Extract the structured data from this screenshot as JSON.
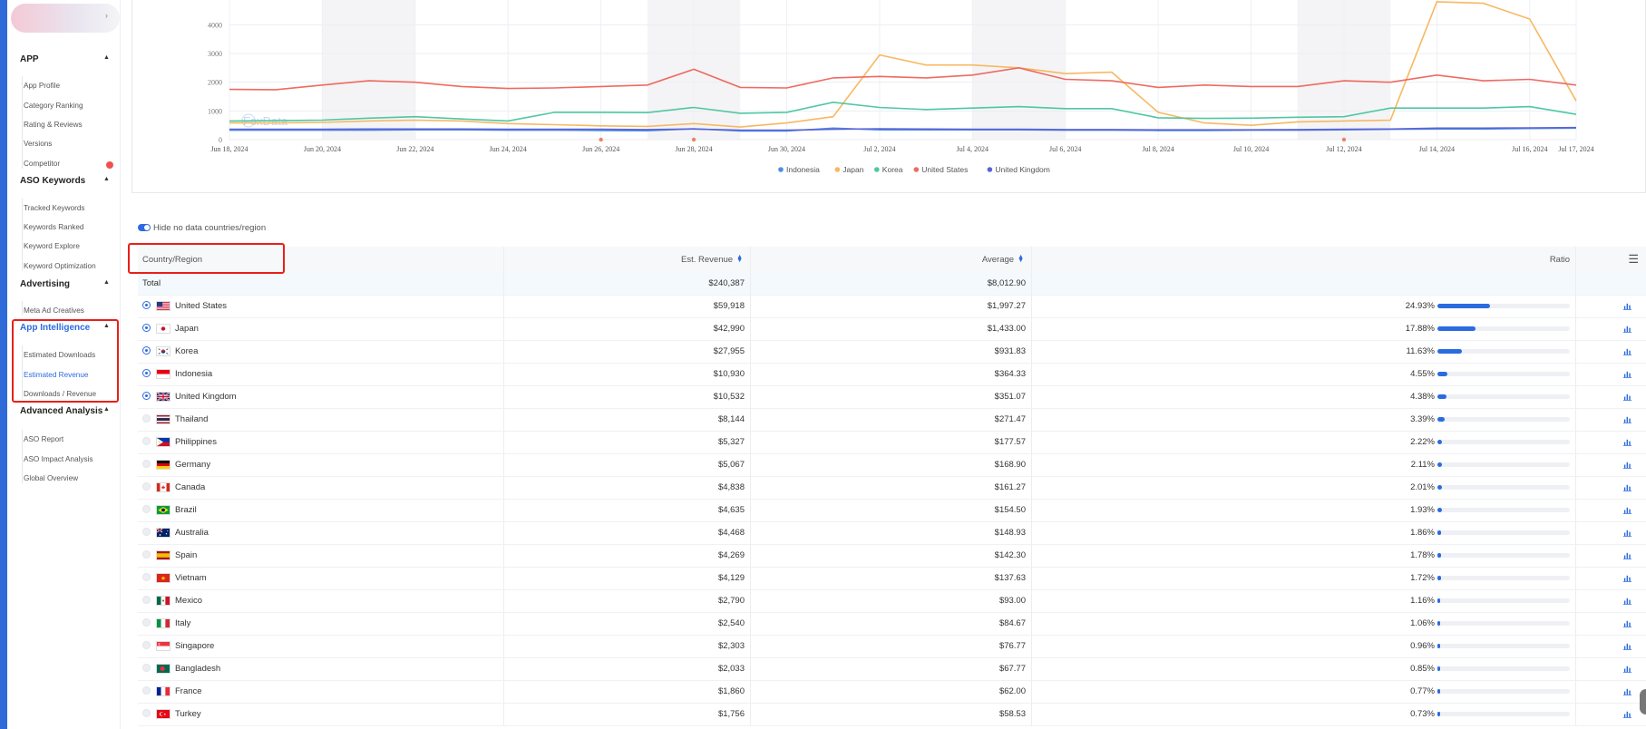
{
  "sidebar": {
    "sections": [
      {
        "title": "APP",
        "items": [
          "App Profile",
          "Category Ranking",
          "Rating & Reviews",
          "Versions",
          "Competitor"
        ]
      },
      {
        "title": "ASO Keywords",
        "items": [
          "Tracked Keywords",
          "Keywords Ranked",
          "Keyword Explore",
          "Keyword Optimization"
        ]
      },
      {
        "title": "Advertising",
        "items": [
          "Meta Ad Creatives"
        ]
      },
      {
        "title": "App Intelligence",
        "items": [
          "Estimated Downloads",
          "Estimated Revenue",
          "Downloads / Revenue"
        ]
      },
      {
        "title": "Advanced Analysis",
        "items": [
          "ASO Report",
          "ASO Impact Analysis",
          "Global Overview"
        ]
      }
    ],
    "active_section": "App Intelligence",
    "active_item": "Estimated Revenue",
    "accent_color": "#2d6be0"
  },
  "chart_data": {
    "type": "line",
    "x": [
      "Jun 18, 2024",
      "Jun 19, 2024",
      "Jun 20, 2024",
      "Jun 21, 2024",
      "Jun 22, 2024",
      "Jun 23, 2024",
      "Jun 24, 2024",
      "Jun 25, 2024",
      "Jun 26, 2024",
      "Jun 27, 2024",
      "Jun 28, 2024",
      "Jun 29, 2024",
      "Jun 30, 2024",
      "Jul 1, 2024",
      "Jul 2, 2024",
      "Jul 3, 2024",
      "Jul 4, 2024",
      "Jul 5, 2024",
      "Jul 6, 2024",
      "Jul 7, 2024",
      "Jul 8, 2024",
      "Jul 9, 2024",
      "Jul 10, 2024",
      "Jul 11, 2024",
      "Jul 12, 2024",
      "Jul 13, 2024",
      "Jul 14, 2024",
      "Jul 15, 2024",
      "Jul 16, 2024",
      "Jul 17, 2024"
    ],
    "x_tick_labels": [
      "Jun 18, 2024",
      "Jun 20, 2024",
      "Jun 22, 2024",
      "Jun 24, 2024",
      "Jun 26, 2024",
      "Jun 28, 2024",
      "Jun 30, 2024",
      "Jul 2, 2024",
      "Jul 4, 2024",
      "Jul 6, 2024",
      "Jul 8, 2024",
      "Jul 10, 2024",
      "Jul 12, 2024",
      "Jul 14, 2024",
      "Jul 16, 2024",
      "Jul 17, 2024"
    ],
    "y_tick_labels": [
      "0",
      "1000",
      "2000",
      "3000",
      "4000"
    ],
    "ylim": [
      0,
      4800
    ],
    "series": [
      {
        "name": "Indonesia",
        "color": "#4d8fe0",
        "values": [
          330,
          330,
          330,
          330,
          340,
          340,
          330,
          330,
          320,
          310,
          380,
          300,
          300,
          400,
          340,
          340,
          340,
          340,
          330,
          330,
          320,
          320,
          330,
          330,
          340,
          360,
          370,
          370,
          390,
          400
        ]
      },
      {
        "name": "Japan",
        "color": "#f7b862",
        "values": [
          580,
          580,
          600,
          650,
          680,
          650,
          560,
          520,
          480,
          460,
          560,
          440,
          580,
          800,
          2950,
          2600,
          2600,
          2500,
          2300,
          2350,
          950,
          580,
          500,
          620,
          650,
          680,
          4800,
          4750,
          4200,
          1350
        ]
      },
      {
        "name": "Korea",
        "color": "#4fc7a3",
        "values": [
          650,
          660,
          680,
          750,
          800,
          720,
          650,
          950,
          950,
          940,
          1120,
          920,
          950,
          1300,
          1120,
          1050,
          1100,
          1150,
          1080,
          1080,
          760,
          740,
          750,
          780,
          800,
          1100,
          1100,
          1100,
          1150,
          880
        ]
      },
      {
        "name": "United States",
        "color": "#ef6a60",
        "values": [
          1750,
          1740,
          1900,
          2050,
          2000,
          1850,
          1780,
          1800,
          1850,
          1900,
          2450,
          1820,
          1800,
          2150,
          2200,
          2150,
          2250,
          2500,
          2100,
          2050,
          1820,
          1900,
          1850,
          1850,
          2050,
          2000,
          2250,
          2050,
          2100,
          1900
        ]
      },
      {
        "name": "United Kingdom",
        "color": "#5a63d8",
        "values": [
          360,
          360,
          360,
          370,
          370,
          370,
          360,
          360,
          360,
          350,
          370,
          330,
          330,
          360,
          380,
          370,
          360,
          360,
          350,
          350,
          340,
          340,
          340,
          350,
          360,
          370,
          400,
          400,
          410,
          420
        ]
      }
    ],
    "grid": true,
    "legend": "bottom-center",
    "watermark": "FoxData"
  },
  "toggle": {
    "label": "Hide no data countries/region",
    "on": true
  },
  "table": {
    "headers": {
      "country": "Country/Region",
      "revenue": "Est. Revenue",
      "average": "Average",
      "ratio": "Ratio"
    },
    "total": {
      "label": "Total",
      "revenue": "$240,387",
      "average": "$8,012.90"
    },
    "rows": [
      {
        "country": "United States",
        "flag": "us",
        "selected": true,
        "revenue": "$59,918",
        "average": "$1,997.27",
        "ratio": "24.93%",
        "ratio_value": 24.93
      },
      {
        "country": "Japan",
        "flag": "jp",
        "selected": true,
        "revenue": "$42,990",
        "average": "$1,433.00",
        "ratio": "17.88%",
        "ratio_value": 17.88
      },
      {
        "country": "Korea",
        "flag": "kr",
        "selected": true,
        "revenue": "$27,955",
        "average": "$931.83",
        "ratio": "11.63%",
        "ratio_value": 11.63
      },
      {
        "country": "Indonesia",
        "flag": "id",
        "selected": true,
        "revenue": "$10,930",
        "average": "$364.33",
        "ratio": "4.55%",
        "ratio_value": 4.55
      },
      {
        "country": "United Kingdom",
        "flag": "gb",
        "selected": true,
        "revenue": "$10,532",
        "average": "$351.07",
        "ratio": "4.38%",
        "ratio_value": 4.38
      },
      {
        "country": "Thailand",
        "flag": "th",
        "selected": false,
        "revenue": "$8,144",
        "average": "$271.47",
        "ratio": "3.39%",
        "ratio_value": 3.39
      },
      {
        "country": "Philippines",
        "flag": "ph",
        "selected": false,
        "revenue": "$5,327",
        "average": "$177.57",
        "ratio": "2.22%",
        "ratio_value": 2.22
      },
      {
        "country": "Germany",
        "flag": "de",
        "selected": false,
        "revenue": "$5,067",
        "average": "$168.90",
        "ratio": "2.11%",
        "ratio_value": 2.11
      },
      {
        "country": "Canada",
        "flag": "ca",
        "selected": false,
        "revenue": "$4,838",
        "average": "$161.27",
        "ratio": "2.01%",
        "ratio_value": 2.01
      },
      {
        "country": "Brazil",
        "flag": "br",
        "selected": false,
        "revenue": "$4,635",
        "average": "$154.50",
        "ratio": "1.93%",
        "ratio_value": 1.93
      },
      {
        "country": "Australia",
        "flag": "au",
        "selected": false,
        "revenue": "$4,468",
        "average": "$148.93",
        "ratio": "1.86%",
        "ratio_value": 1.86
      },
      {
        "country": "Spain",
        "flag": "es",
        "selected": false,
        "revenue": "$4,269",
        "average": "$142.30",
        "ratio": "1.78%",
        "ratio_value": 1.78
      },
      {
        "country": "Vietnam",
        "flag": "vn",
        "selected": false,
        "revenue": "$4,129",
        "average": "$137.63",
        "ratio": "1.72%",
        "ratio_value": 1.72
      },
      {
        "country": "Mexico",
        "flag": "mx",
        "selected": false,
        "revenue": "$2,790",
        "average": "$93.00",
        "ratio": "1.16%",
        "ratio_value": 1.16
      },
      {
        "country": "Italy",
        "flag": "it",
        "selected": false,
        "revenue": "$2,540",
        "average": "$84.67",
        "ratio": "1.06%",
        "ratio_value": 1.06
      },
      {
        "country": "Singapore",
        "flag": "sg",
        "selected": false,
        "revenue": "$2,303",
        "average": "$76.77",
        "ratio": "0.96%",
        "ratio_value": 0.96
      },
      {
        "country": "Bangladesh",
        "flag": "bd",
        "selected": false,
        "revenue": "$2,033",
        "average": "$67.77",
        "ratio": "0.85%",
        "ratio_value": 0.85
      },
      {
        "country": "France",
        "flag": "fr",
        "selected": false,
        "revenue": "$1,860",
        "average": "$62.00",
        "ratio": "0.77%",
        "ratio_value": 0.77
      },
      {
        "country": "Turkey",
        "flag": "tr",
        "selected": false,
        "revenue": "$1,756",
        "average": "$58.53",
        "ratio": "0.73%",
        "ratio_value": 0.73
      }
    ]
  }
}
